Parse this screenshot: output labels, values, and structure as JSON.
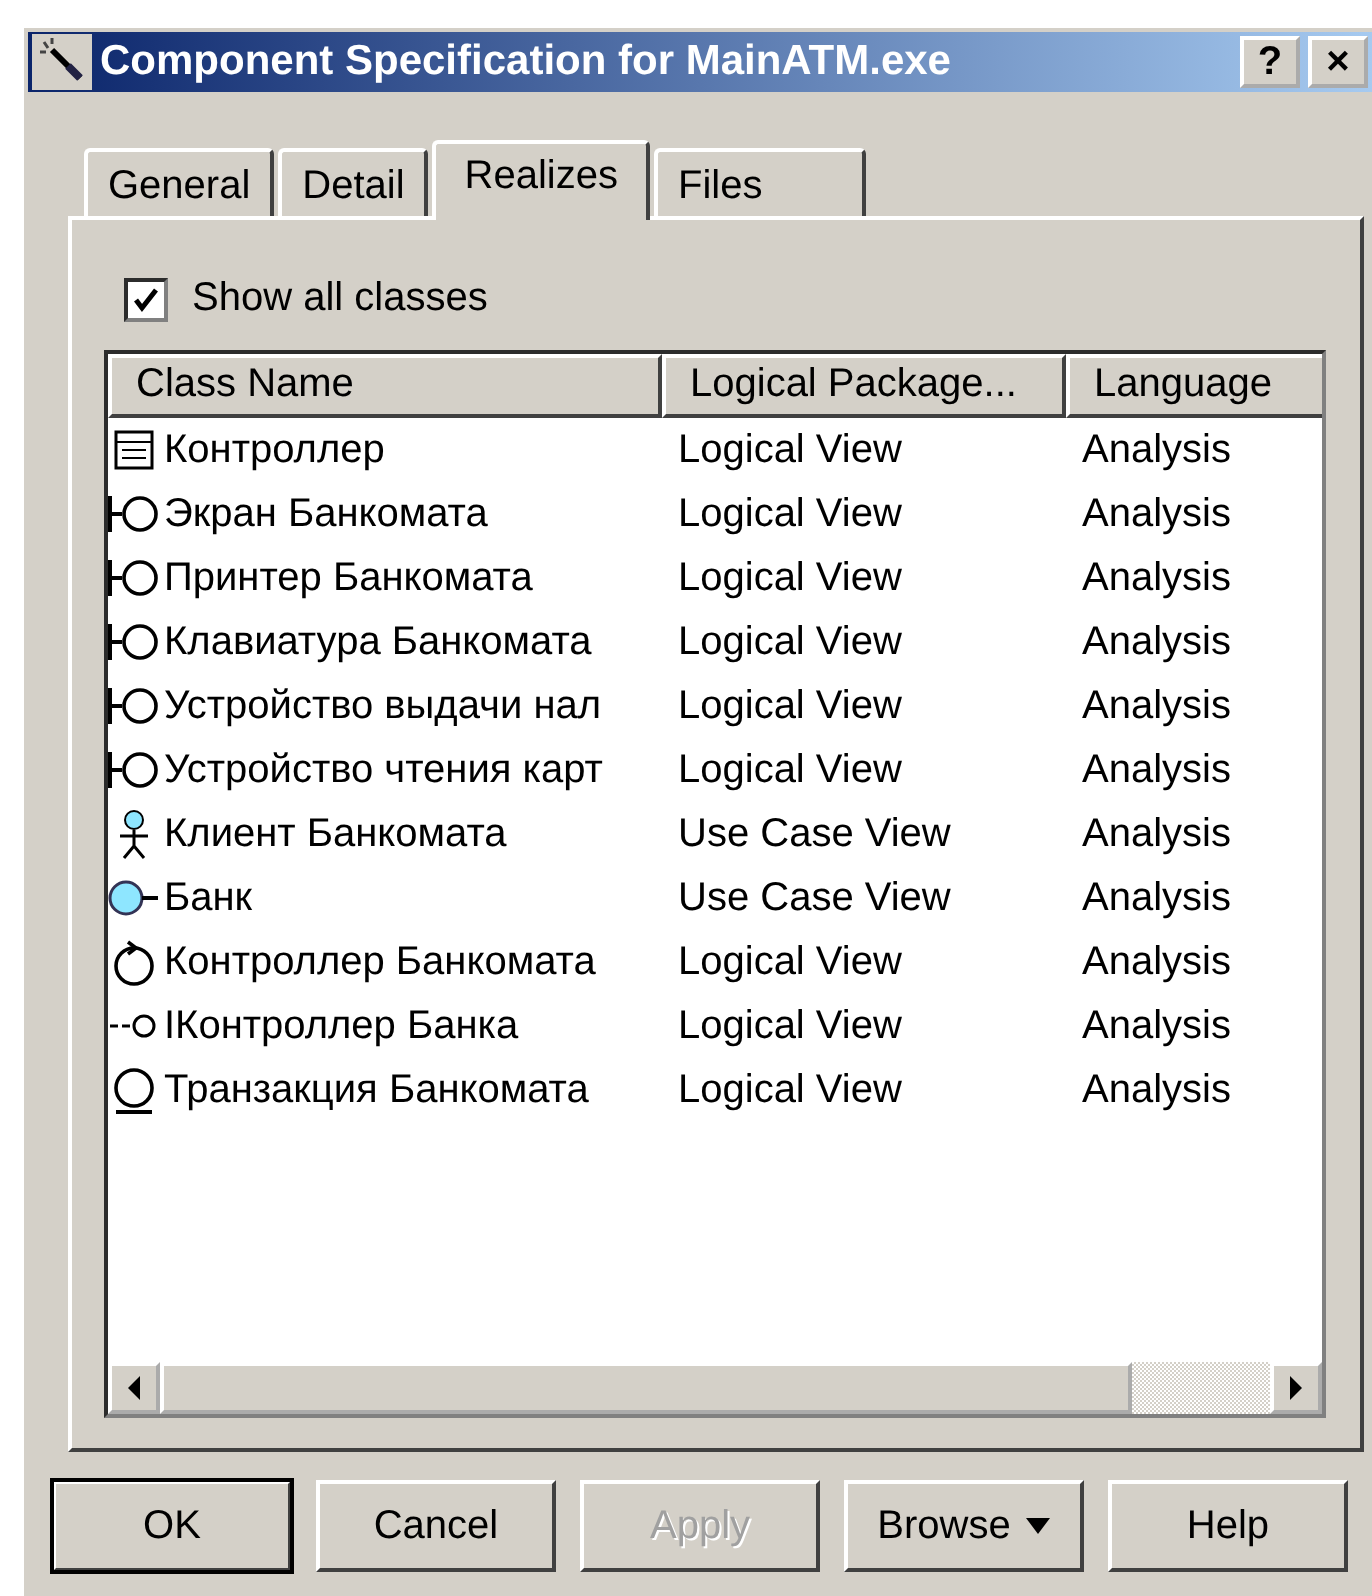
{
  "window": {
    "title": "Component Specification for MainATM.exe",
    "title_buttons": [
      "?",
      "×"
    ]
  },
  "tabs": [
    {
      "label": "General",
      "selected": false
    },
    {
      "label": "Detail",
      "selected": false
    },
    {
      "label": "Realizes",
      "selected": true
    },
    {
      "label": "Files",
      "selected": false
    }
  ],
  "show_all_classes": {
    "label": "Show all classes",
    "checked": true
  },
  "table": {
    "columns": [
      "Class Name",
      "Logical Package...",
      "Language"
    ],
    "rows": [
      {
        "kind": "class",
        "cells": [
          "Контроллер",
          "Logical View",
          "Analysis"
        ]
      },
      {
        "kind": "boundary",
        "cells": [
          "Экран Банкомата",
          "Logical View",
          "Analysis"
        ]
      },
      {
        "kind": "boundary",
        "cells": [
          "Принтер Банкомата",
          "Logical View",
          "Analysis"
        ]
      },
      {
        "kind": "boundary",
        "cells": [
          "Клавиатура Банкомата",
          "Logical View",
          "Analysis"
        ]
      },
      {
        "kind": "boundary",
        "cells": [
          "Устройство выдачи нал",
          "Logical View",
          "Analysis"
        ]
      },
      {
        "kind": "boundary",
        "cells": [
          "Устройство чтения карт",
          "Logical View",
          "Analysis"
        ]
      },
      {
        "kind": "actor",
        "cells": [
          "Клиент Банкомата",
          "Use Case View",
          "Analysis"
        ]
      },
      {
        "kind": "business-actor",
        "cells": [
          "Банк",
          "Use Case View",
          "Analysis"
        ]
      },
      {
        "kind": "control",
        "cells": [
          "Контроллер Банкомата",
          "Logical View",
          "Analysis"
        ]
      },
      {
        "kind": "interface",
        "cells": [
          "IКонтроллер Банка",
          "Logical View",
          "Analysis"
        ]
      },
      {
        "kind": "entity",
        "cells": [
          "Транзакция Банкомата",
          "Logical View",
          "Analysis"
        ]
      }
    ]
  },
  "buttons": [
    {
      "label": "OK",
      "disabled": false,
      "default": true
    },
    {
      "label": "Cancel",
      "disabled": false,
      "default": false
    },
    {
      "label": "Apply",
      "disabled": true,
      "default": false
    },
    {
      "label": "Browse",
      "disabled": false,
      "default": false,
      "dropdown": true
    },
    {
      "label": "Help",
      "disabled": false,
      "default": false
    }
  ]
}
